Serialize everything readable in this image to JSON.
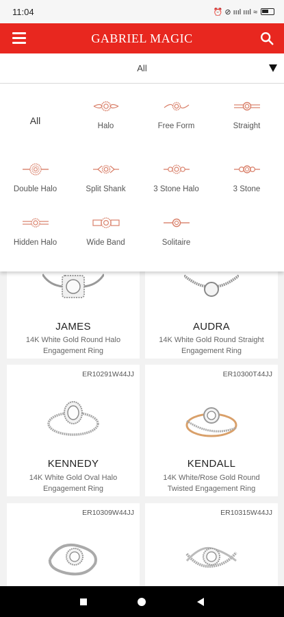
{
  "status": {
    "time": "11:04",
    "icons": "⏰ ⊘ ıııl ıııl ≈"
  },
  "appbar": {
    "title": "GABRIEL MAGIC",
    "accent": "#e8271f"
  },
  "filter": {
    "selected": "All"
  },
  "categories": [
    {
      "label": "All"
    },
    {
      "label": "Halo"
    },
    {
      "label": "Free Form"
    },
    {
      "label": "Straight"
    },
    {
      "label": "Double Halo"
    },
    {
      "label": "Split Shank"
    },
    {
      "label": "3 Stone Halo"
    },
    {
      "label": "3 Stone"
    },
    {
      "label": "Hidden Halo"
    },
    {
      "label": "Wide Band"
    },
    {
      "label": "Solitaire"
    }
  ],
  "products": [
    {
      "sku": "",
      "name": "JAMES",
      "desc": "14K White Gold Round Halo Engagement Ring"
    },
    {
      "sku": "",
      "name": "AUDRA",
      "desc": "14K White Gold Round Straight Engagement Ring"
    },
    {
      "sku": "ER10291W44JJ",
      "name": "KENNEDY",
      "desc": "14K White Gold Oval Halo Engagement Ring"
    },
    {
      "sku": "ER10300T44JJ",
      "name": "KENDALL",
      "desc": "14K White/Rose Gold Round Twisted Engagement Ring"
    },
    {
      "sku": "ER10309W44JJ",
      "name": "",
      "desc": ""
    },
    {
      "sku": "ER10315W44JJ",
      "name": "",
      "desc": ""
    }
  ]
}
